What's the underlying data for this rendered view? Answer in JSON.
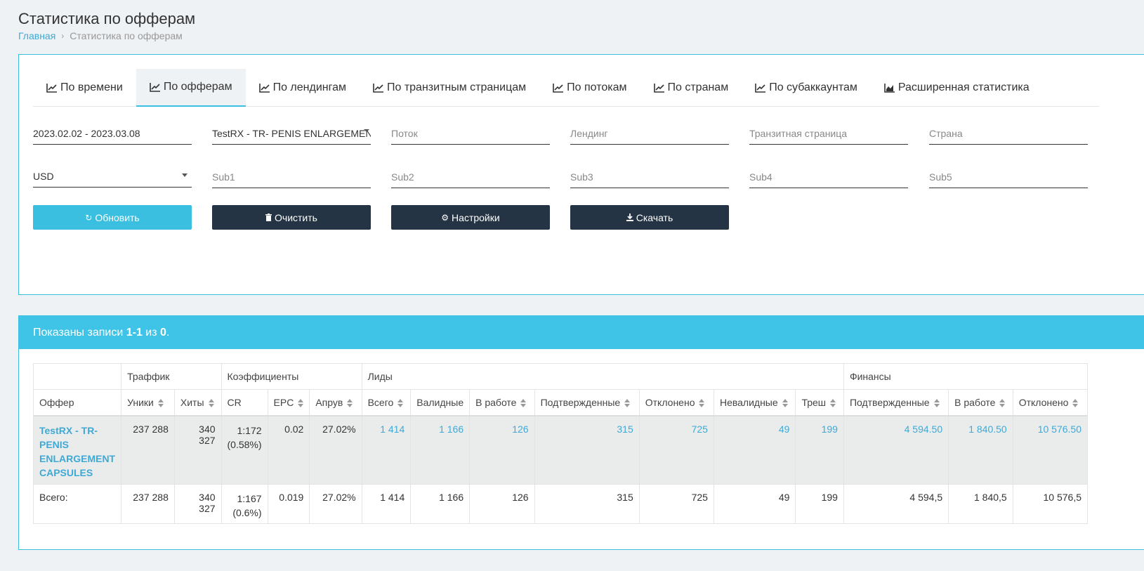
{
  "page": {
    "title": "Статистика по офферам"
  },
  "breadcrumb": {
    "home": "Главная",
    "current": "Статистика по офферам"
  },
  "tabs": [
    {
      "label": "По времени"
    },
    {
      "label": "По офферам"
    },
    {
      "label": "По лендингам"
    },
    {
      "label": "По транзитным страницам"
    },
    {
      "label": "По потокам"
    },
    {
      "label": "По странам"
    },
    {
      "label": "По субаккаунтам"
    },
    {
      "label": "Расширенная статистика"
    }
  ],
  "filters": {
    "date": "2023.02.02 - 2023.03.08",
    "offer": "TestRX - TR- PENIS ENLARGEMENT C",
    "flow_placeholder": "Поток",
    "landing_placeholder": "Лендинг",
    "transit_placeholder": "Транзитная страница",
    "country_placeholder": "Страна",
    "currency": "USD",
    "sub1": "Sub1",
    "sub2": "Sub2",
    "sub3": "Sub3",
    "sub4": "Sub4",
    "sub5": "Sub5"
  },
  "buttons": {
    "refresh": "Обновить",
    "clear": "Очистить",
    "settings": "Настройки",
    "download": "Скачать"
  },
  "summary": {
    "prefix": "Показаны записи ",
    "range": "1-1",
    "mid": " из ",
    "total": "0",
    "suffix": "."
  },
  "table": {
    "groups": {
      "traffic": "Траффик",
      "coef": "Коэффициенты",
      "leads": "Лиды",
      "finance": "Финансы"
    },
    "columns": [
      "Оффер",
      "Уники",
      "Хиты",
      "CR",
      "EPC",
      "Апрув",
      "Всего",
      "Валидные",
      "В работе",
      "Подтвержденные",
      "Отклонено",
      "Невалидные",
      "Треш",
      "Подтвержденные",
      "В работе",
      "Отклонено"
    ],
    "row": {
      "offer": "TestRX - TR- PENIS ENLARGEMENT CAPSULES",
      "uniques": "237 288",
      "hits": "340 327",
      "cr": "1:172",
      "cr_pct": "(0.58%)",
      "epc": "0.02",
      "approve": "27.02%",
      "total": "1 414",
      "valid": "1 166",
      "in_work": "126",
      "confirmed": "315",
      "rejected": "725",
      "invalid": "49",
      "trash": "199",
      "fin_confirmed": "4 594.50",
      "fin_in_work": "1 840.50",
      "fin_rejected": "10 576.50"
    },
    "totals": {
      "label": "Всего:",
      "uniques": "237 288",
      "hits": "340 327",
      "cr": "1:167",
      "cr_pct": "(0.6%)",
      "epc": "0.019",
      "approve": "27.02%",
      "total": "1 414",
      "valid": "1 166",
      "in_work": "126",
      "confirmed": "315",
      "rejected": "725",
      "invalid": "49",
      "trash": "199",
      "fin_confirmed": "4 594,5",
      "fin_in_work": "1 840,5",
      "fin_rejected": "10 576,5"
    }
  }
}
